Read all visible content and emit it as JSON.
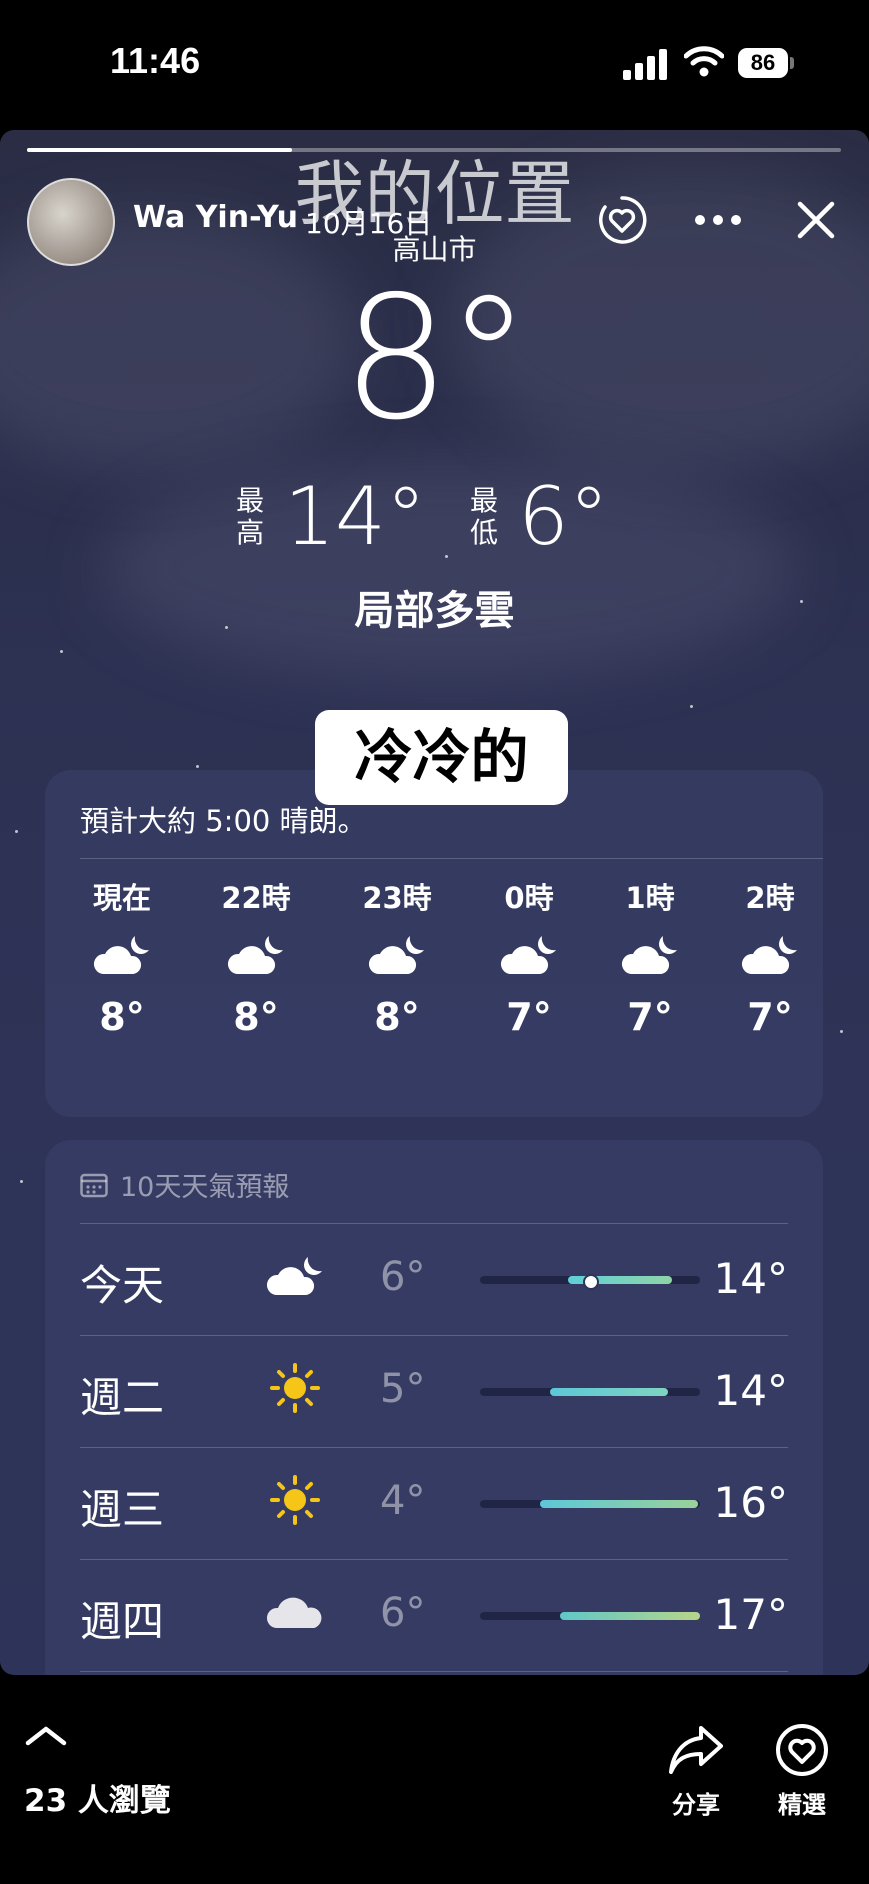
{
  "status_bar": {
    "time": "11:46",
    "battery": "86"
  },
  "story": {
    "overlay_location": "我的位置",
    "user_name": "Wa Yin-Yu",
    "date": "10月16日",
    "sticker_text": "冷冷的"
  },
  "weather": {
    "city": "高山市",
    "temperature": "8°",
    "high_label": "最高",
    "high": "14°",
    "low_label": "最低",
    "low": "6°",
    "condition": "局部多雲",
    "summary": "預計大約 5:00 晴朗。",
    "hourly": [
      {
        "label": "現在",
        "icon": "cloud-moon-icon",
        "temp": "8°"
      },
      {
        "label": "22時",
        "icon": "cloud-moon-icon",
        "temp": "8°"
      },
      {
        "label": "23時",
        "icon": "cloud-moon-icon",
        "temp": "8°"
      },
      {
        "label": "0時",
        "icon": "cloud-moon-icon",
        "temp": "7°"
      },
      {
        "label": "1時",
        "icon": "cloud-moon-icon",
        "temp": "7°"
      },
      {
        "label": "2時",
        "icon": "cloud-moon-icon",
        "temp": "7°"
      }
    ],
    "forecast_title": "10天天氣預報",
    "forecast": [
      {
        "day": "今天",
        "icon": "cloud-moon-icon",
        "low": "6°",
        "high": "14°"
      },
      {
        "day": "週二",
        "icon": "sun-icon",
        "low": "5°",
        "high": "14°"
      },
      {
        "day": "週三",
        "icon": "sun-icon",
        "low": "4°",
        "high": "16°"
      },
      {
        "day": "週四",
        "icon": "cloud-icon",
        "low": "6°",
        "high": "17°"
      }
    ]
  },
  "bottom_bar": {
    "viewers": "23 人瀏覽",
    "share_label": "分享",
    "highlight_label": "精選"
  },
  "colors": {
    "bar_start": "#5fd0d8",
    "bar_end": "#9ad19a",
    "sun": "#f5c518"
  }
}
